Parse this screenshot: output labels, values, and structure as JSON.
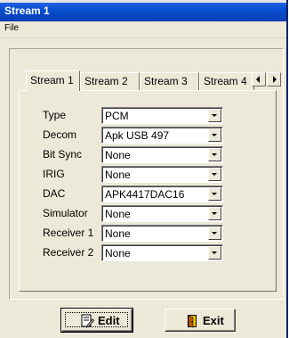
{
  "window": {
    "title": "Stream 1"
  },
  "menu": {
    "file": "File"
  },
  "tabs": [
    {
      "label": "Stream 1",
      "active": true
    },
    {
      "label": "Stream 2",
      "active": false
    },
    {
      "label": "Stream 3",
      "active": false
    },
    {
      "label": "Stream 4",
      "active": false
    }
  ],
  "fields": [
    {
      "label": "Type",
      "value": "PCM"
    },
    {
      "label": "Decom",
      "value": "Apk USB 497"
    },
    {
      "label": "Bit Sync",
      "value": "None"
    },
    {
      "label": "IRIG",
      "value": "None"
    },
    {
      "label": "DAC",
      "value": "APK4417DAC16"
    },
    {
      "label": "Simulator",
      "value": "None"
    },
    {
      "label": "Receiver 1",
      "value": "None"
    },
    {
      "label": "Receiver 2",
      "value": "None"
    }
  ],
  "buttons": {
    "edit": "Edit",
    "exit": "Exit"
  },
  "icons": {
    "edit": "edit-document-icon",
    "exit": "exit-door-icon",
    "tab_scroll_left": "chevron-left-icon",
    "tab_scroll_right": "chevron-right-icon",
    "dropdown": "chevron-down-icon"
  },
  "colors": {
    "titlebar": "#0b4fd4",
    "window_face": "#ece9d8"
  }
}
